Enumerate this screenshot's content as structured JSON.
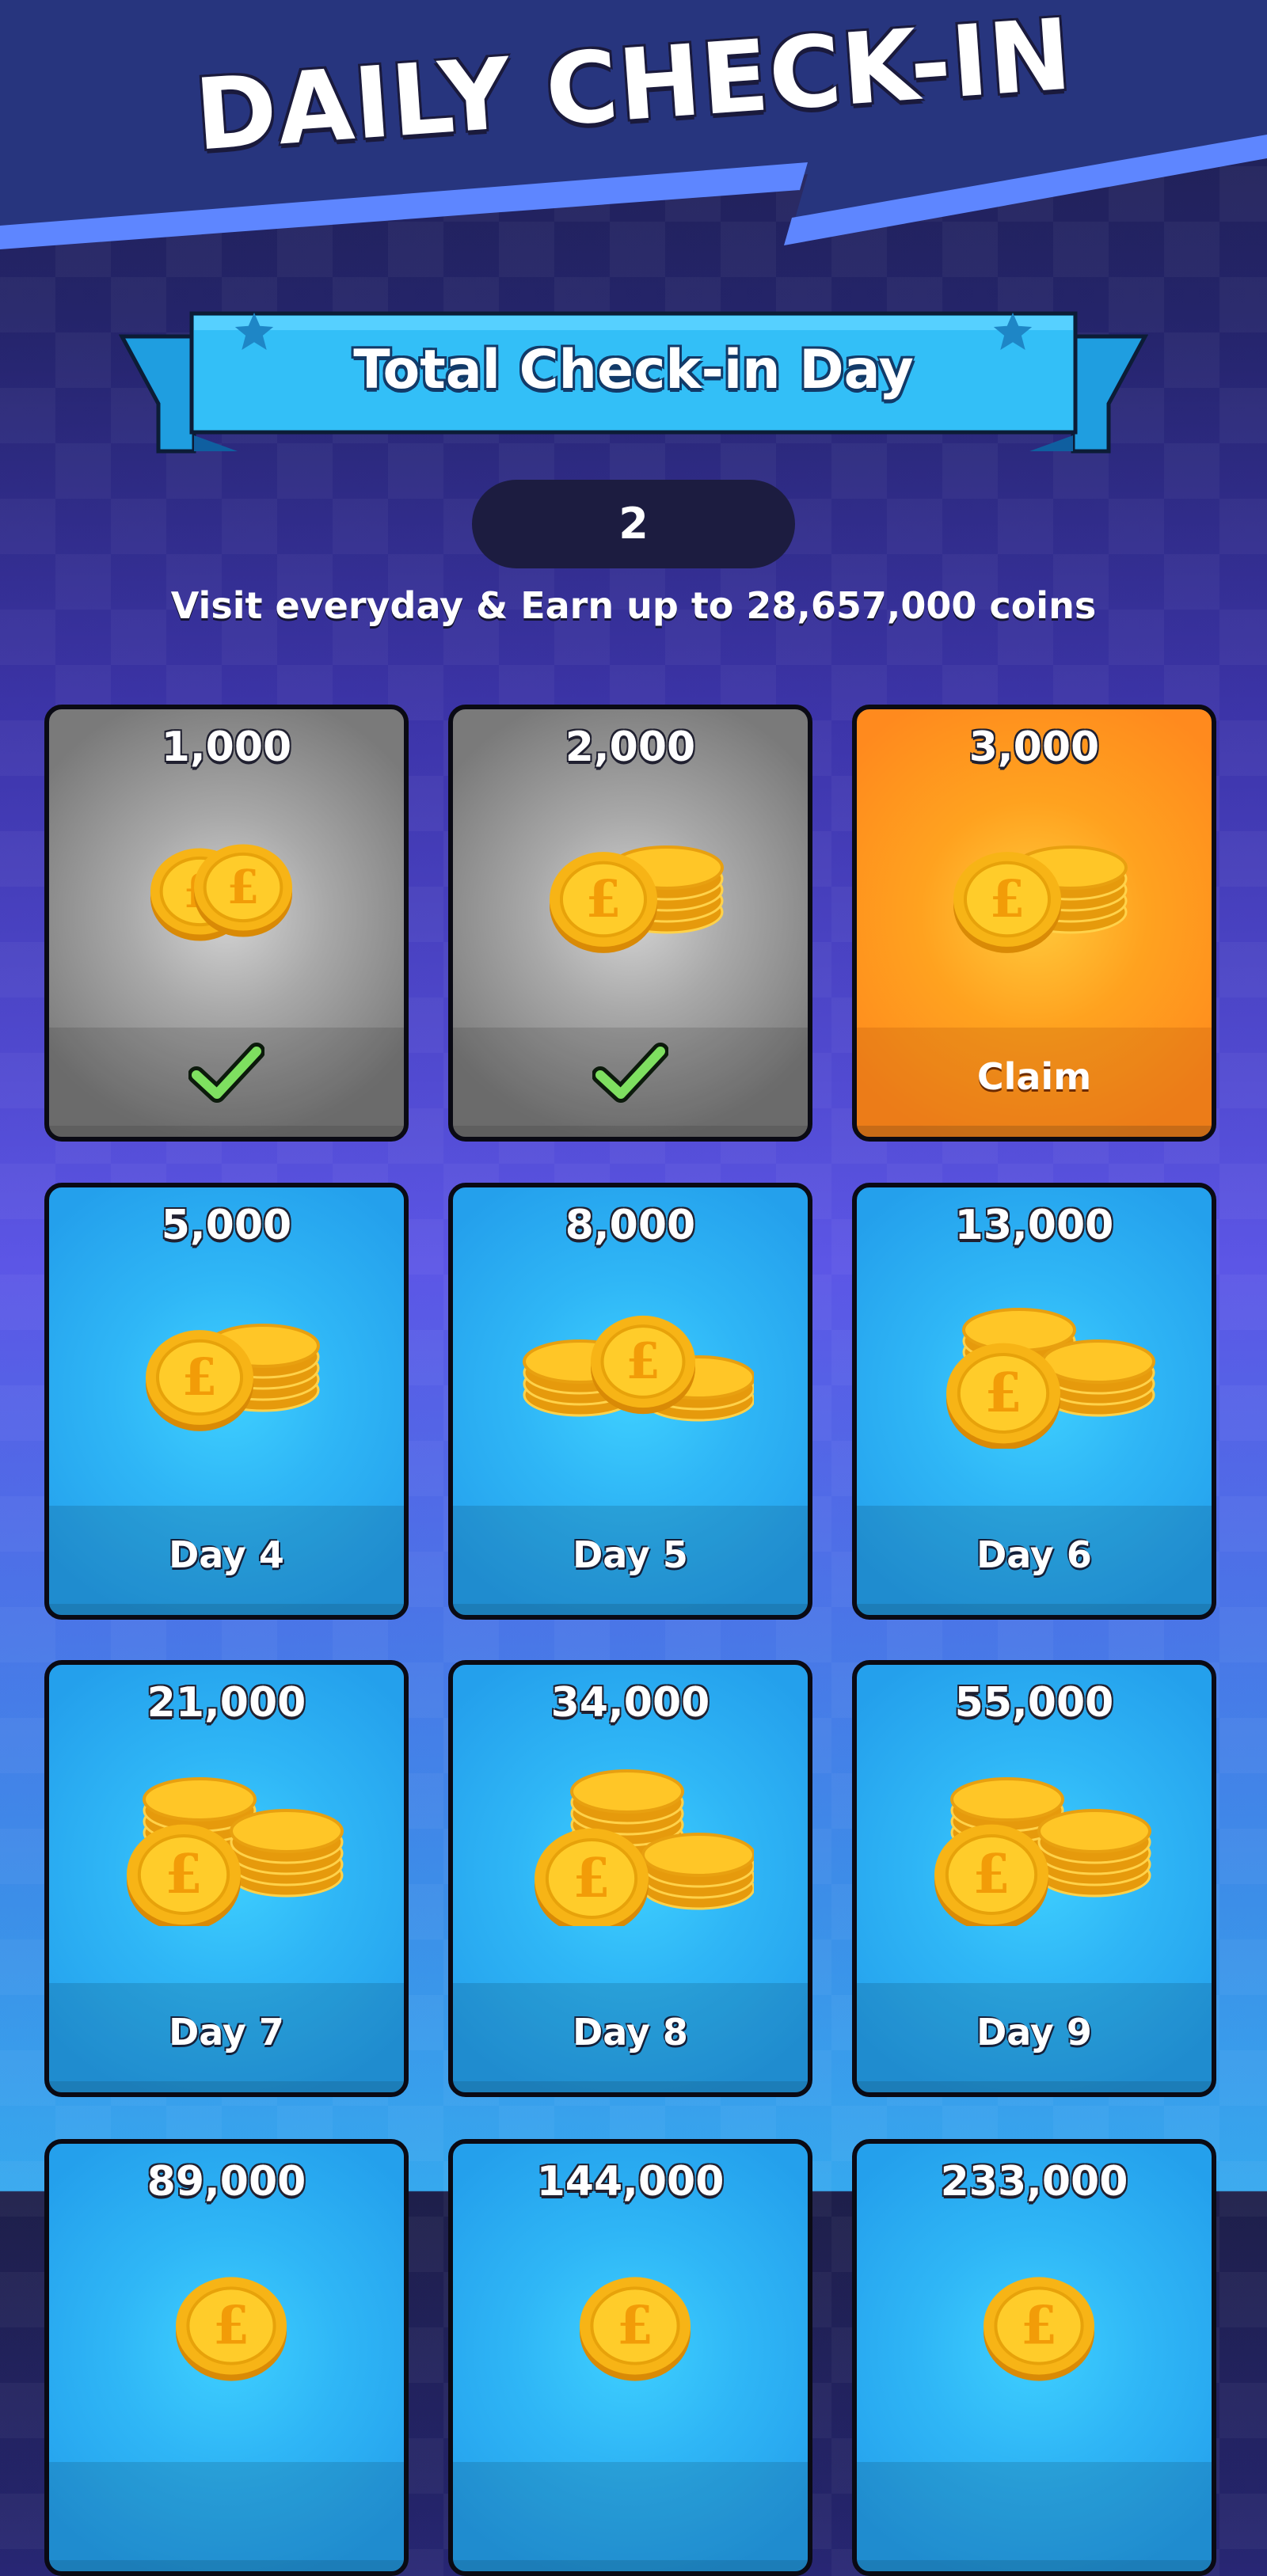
{
  "header": {
    "title": "DAILY CHECK-IN"
  },
  "ribbon": {
    "label": "Total Check-in Day",
    "icons": [
      "star-icon",
      "star-icon"
    ]
  },
  "counter": {
    "value": "2"
  },
  "subtitle": "Visit everyday & Earn up to 28,657,000 coins",
  "cards": [
    {
      "amount": "1,000",
      "state": "claimed",
      "footer": "",
      "icon": "checkmark-icon"
    },
    {
      "amount": "2,000",
      "state": "claimed",
      "footer": "",
      "icon": "checkmark-icon"
    },
    {
      "amount": "3,000",
      "state": "claimable",
      "footer": "Claim"
    },
    {
      "amount": "5,000",
      "state": "locked",
      "footer": "Day 4"
    },
    {
      "amount": "8,000",
      "state": "locked",
      "footer": "Day 5"
    },
    {
      "amount": "13,000",
      "state": "locked",
      "footer": "Day 6"
    },
    {
      "amount": "21,000",
      "state": "locked",
      "footer": "Day 7"
    },
    {
      "amount": "34,000",
      "state": "locked",
      "footer": "Day 8"
    },
    {
      "amount": "55,000",
      "state": "locked",
      "footer": "Day 9"
    },
    {
      "amount": "89,000",
      "state": "locked",
      "footer": ""
    },
    {
      "amount": "144,000",
      "state": "locked",
      "footer": ""
    },
    {
      "amount": "233,000",
      "state": "locked",
      "footer": ""
    }
  ],
  "colors": {
    "claimed": "#8c8c8c",
    "claimable": "#ff9a1e",
    "locked": "#2fb6f6",
    "check": "#7ee060"
  }
}
